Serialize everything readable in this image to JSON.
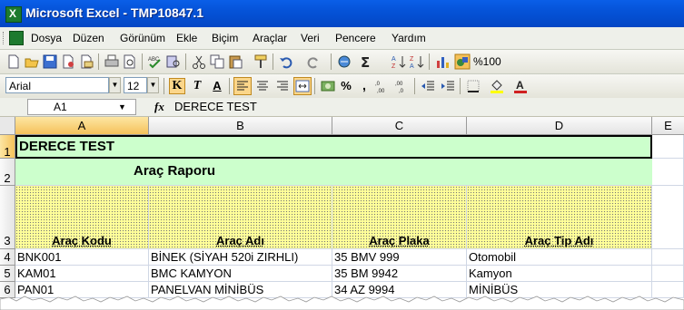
{
  "window": {
    "title": "Microsoft Excel - TMP10847.1"
  },
  "menu": {
    "items": [
      "Dosya",
      "Düzen",
      "Görünüm",
      "Ekle",
      "Biçim",
      "Araçlar",
      "Veri",
      "Pencere",
      "Yardım"
    ]
  },
  "toolbar": {
    "zoom": "%100",
    "font_name": "Arial",
    "font_size": "12"
  },
  "formula_bar": {
    "cell_ref": "A1",
    "fx": "fx",
    "content": "DERECE TEST"
  },
  "columns": [
    "A",
    "B",
    "C",
    "D",
    "E"
  ],
  "rows": [
    "1",
    "2",
    "3",
    "4",
    "5",
    "6"
  ],
  "sheet": {
    "title": "DERECE TEST",
    "subtitle": "Araç Raporu",
    "headers": [
      "Araç Kodu",
      "Araç Adı",
      "Araç Plaka",
      "Araç Tip Adı"
    ],
    "data": [
      [
        "BNK001",
        "BİNEK (SİYAH 520i ZIRHLI)",
        "35 BMV 999",
        "Otomobil"
      ],
      [
        "KAM01",
        "BMC KAMYON",
        "35 BM 9942",
        "Kamyon"
      ],
      [
        "PAN01",
        "PANELVAN MİNİBÜS",
        "34 AZ 9994",
        "MİNİBÜS"
      ]
    ]
  },
  "colors": {
    "title_bar": "#0553d8",
    "green_fill": "#ccffcc",
    "header_fill": "#ffff99"
  }
}
